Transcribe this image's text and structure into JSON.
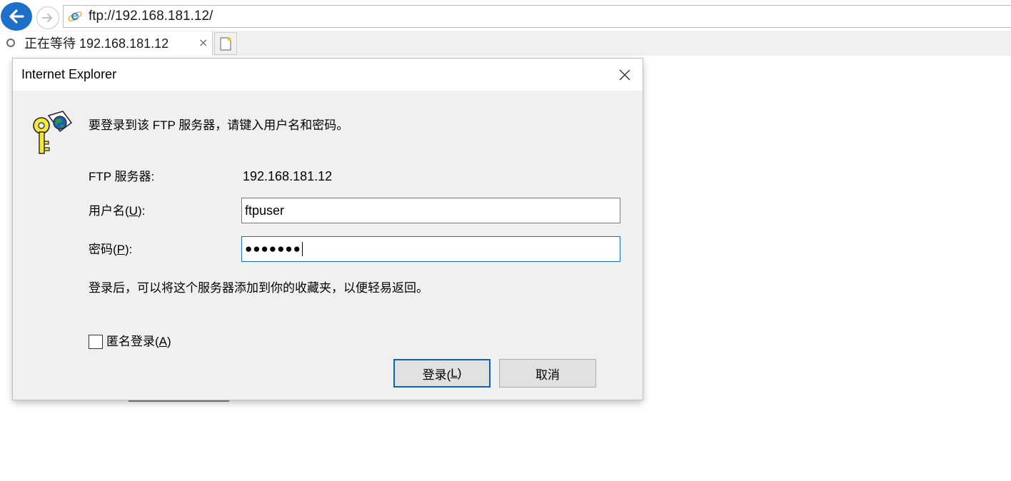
{
  "browser": {
    "address": "ftp://192.168.181.12/",
    "tab_title": "正在等待 192.168.181.12",
    "tab_close": "×"
  },
  "dialog": {
    "title": "Internet Explorer",
    "close": "✕",
    "prompt": "要登录到该 FTP 服务器，请键入用户名和密码。",
    "server_label": "FTP 服务器:",
    "server_value": "192.168.181.12",
    "username_label_pre": "用户名(",
    "username_label_key": "U",
    "username_label_post": "):",
    "username_value": "ftpuser",
    "password_label_pre": "密码(",
    "password_label_key": "P",
    "password_label_post": "):",
    "password_mask": "●●●●●●●",
    "note": "登录后，可以将这个服务器添加到你的收藏夹，以便轻易返回。",
    "anonymous_pre": "匿名登录(",
    "anonymous_key": "A",
    "anonymous_post": ")",
    "anonymous_checked": false,
    "login_pre": "登录(",
    "login_key": "L",
    "login_post": ")",
    "cancel": "取消"
  },
  "colors": {
    "accent": "#1e6fc9",
    "dialog_bg": "#f0f0f0",
    "focus_border": "#1f6fb8"
  },
  "icons": [
    "back-arrow-icon",
    "forward-arrow-icon",
    "ie-logo-icon",
    "loading-spinner-icon",
    "new-tab-icon",
    "close-icon",
    "key-globe-icon"
  ]
}
